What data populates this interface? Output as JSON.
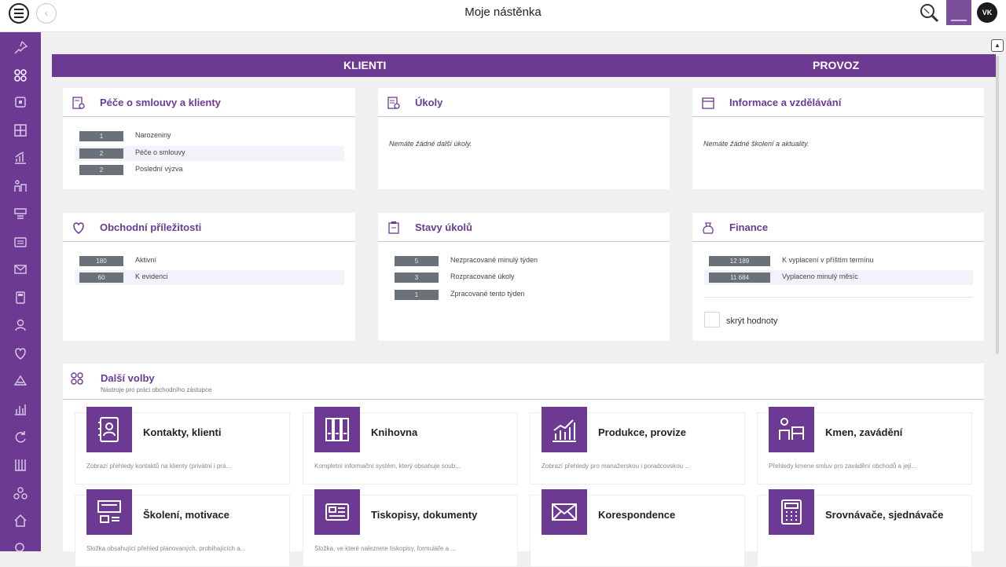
{
  "topbar": {
    "title": "Moje nástěnka",
    "avatar_initials": "VK"
  },
  "tabs": {
    "klienti": "KLIENTI",
    "provoz": "PROVOZ"
  },
  "cards": {
    "pece": {
      "title": "Péče o smlouvy a klienty",
      "rows": [
        {
          "count": "1",
          "label": "Narozeniny"
        },
        {
          "count": "2",
          "label": "Péče o smlouvy"
        },
        {
          "count": "2",
          "label": "Poslední výzva"
        }
      ]
    },
    "ukoly": {
      "title": "Úkoly",
      "note": "Nemáte žádné další úkoly."
    },
    "informace": {
      "title": "Informace a vzdělávání",
      "note": "Nemáte žádné školení a aktuality."
    },
    "prilezitosti": {
      "title": "Obchodní příležitosti",
      "rows": [
        {
          "count": "180",
          "label": "Aktivní"
        },
        {
          "count": "60",
          "label": "K evidenci"
        }
      ]
    },
    "stavy": {
      "title": "Stavy úkolů",
      "rows": [
        {
          "count": "5",
          "label": "Nezpracované minulý týden"
        },
        {
          "count": "3",
          "label": "Rozpracované úkoly"
        },
        {
          "count": "1",
          "label": "Zpracované tento týden"
        }
      ]
    },
    "finance": {
      "title": "Finance",
      "rows": [
        {
          "count": "12 189",
          "label": "K vyplacení v příštím termínu"
        },
        {
          "count": "11 684",
          "label": "Vyplaceno minulý měsíc"
        }
      ],
      "hide_label": "skrýt hodnoty"
    }
  },
  "dalsi": {
    "title": "Další volby",
    "subtitle": "Nástroje pro práci obchodního zástupce",
    "tiles": [
      {
        "title": "Kontakty, klienti",
        "desc": "Zobrazí přehledy kontaktů na klienty (privátní i prá..."
      },
      {
        "title": "Knihovna",
        "desc": "Kompletní informační systém, který obsahuje soub..."
      },
      {
        "title": "Produkce, provize",
        "desc": "Zobrazí přehledy pro manažerskou i poradcovskou ..."
      },
      {
        "title": "Kmen, zavádění",
        "desc": "Přehledy kmene smluv pro zavádění obchodů a její..."
      },
      {
        "title": "Školení, motivace",
        "desc": "Složka obsahující přehled plánovaných, probíhajících a..."
      },
      {
        "title": "Tiskopisy, dokumenty",
        "desc": "Složka, ve které naleznete tiskopisy, formuláře a ..."
      },
      {
        "title": "Korespondence",
        "desc": ""
      },
      {
        "title": "Srovnávače, sjednávače",
        "desc": ""
      }
    ]
  },
  "colors": {
    "accent": "#6c3a93",
    "badge": "#6b7179",
    "background": "#f0f0f0"
  }
}
